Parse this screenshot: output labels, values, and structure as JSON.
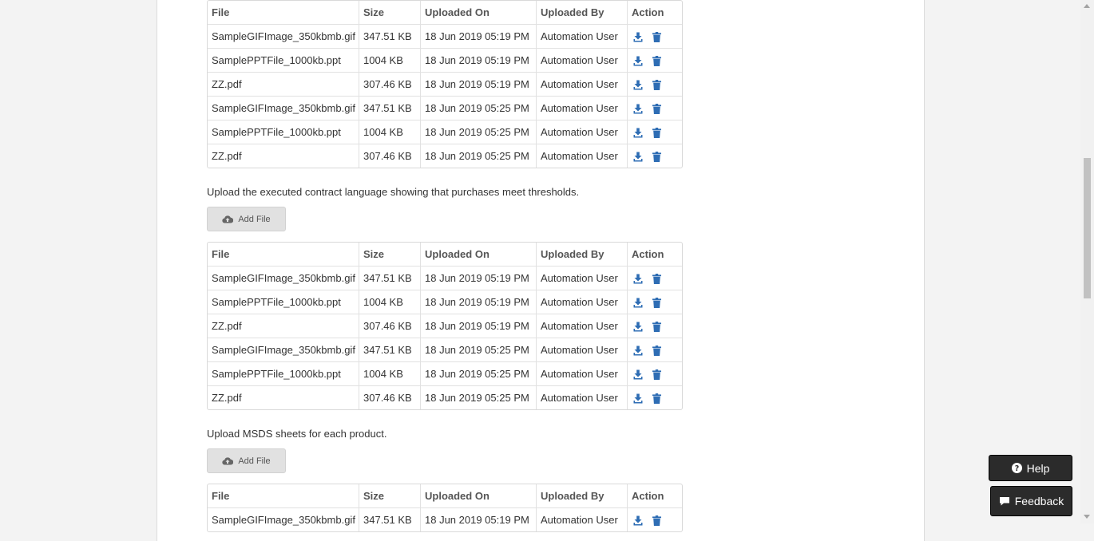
{
  "table_headers": [
    "File",
    "Size",
    "Uploaded On",
    "Uploaded By",
    "Action"
  ],
  "section1": {
    "rows": [
      [
        "SampleGIFImage_350kbmb.gif",
        "347.51 KB",
        "18 Jun 2019 05:19 PM",
        "Automation User"
      ],
      [
        "SamplePPTFile_1000kb.ppt",
        "1004 KB",
        "18 Jun 2019 05:19 PM",
        "Automation User"
      ],
      [
        "ZZ.pdf",
        "307.46 KB",
        "18 Jun 2019 05:19 PM",
        "Automation User"
      ],
      [
        "SampleGIFImage_350kbmb.gif",
        "347.51 KB",
        "18 Jun 2019 05:25 PM",
        "Automation User"
      ],
      [
        "SamplePPTFile_1000kb.ppt",
        "1004 KB",
        "18 Jun 2019 05:25 PM",
        "Automation User"
      ],
      [
        "ZZ.pdf",
        "307.46 KB",
        "18 Jun 2019 05:25 PM",
        "Automation User"
      ]
    ]
  },
  "section2": {
    "instruction": "Upload the executed contract language showing that purchases meet thresholds.",
    "add_file_label": "Add File",
    "rows": [
      [
        "SampleGIFImage_350kbmb.gif",
        "347.51 KB",
        "18 Jun 2019 05:19 PM",
        "Automation User"
      ],
      [
        "SamplePPTFile_1000kb.ppt",
        "1004 KB",
        "18 Jun 2019 05:19 PM",
        "Automation User"
      ],
      [
        "ZZ.pdf",
        "307.46 KB",
        "18 Jun 2019 05:19 PM",
        "Automation User"
      ],
      [
        "SampleGIFImage_350kbmb.gif",
        "347.51 KB",
        "18 Jun 2019 05:25 PM",
        "Automation User"
      ],
      [
        "SamplePPTFile_1000kb.ppt",
        "1004 KB",
        "18 Jun 2019 05:25 PM",
        "Automation User"
      ],
      [
        "ZZ.pdf",
        "307.46 KB",
        "18 Jun 2019 05:25 PM",
        "Automation User"
      ]
    ]
  },
  "section3": {
    "instruction": "Upload MSDS sheets for each product.",
    "add_file_label": "Add File",
    "rows": [
      [
        "SampleGIFImage_350kbmb.gif",
        "347.51 KB",
        "18 Jun 2019 05:19 PM",
        "Automation User"
      ]
    ]
  },
  "help_label": "Help",
  "feedback_label": "Feedback",
  "icons": {
    "download": "download-icon",
    "delete": "trash-icon",
    "upload": "cloud-upload-icon"
  },
  "colors": {
    "icon_blue": "#2e6db4",
    "button_dark": "#2b2b2b"
  }
}
